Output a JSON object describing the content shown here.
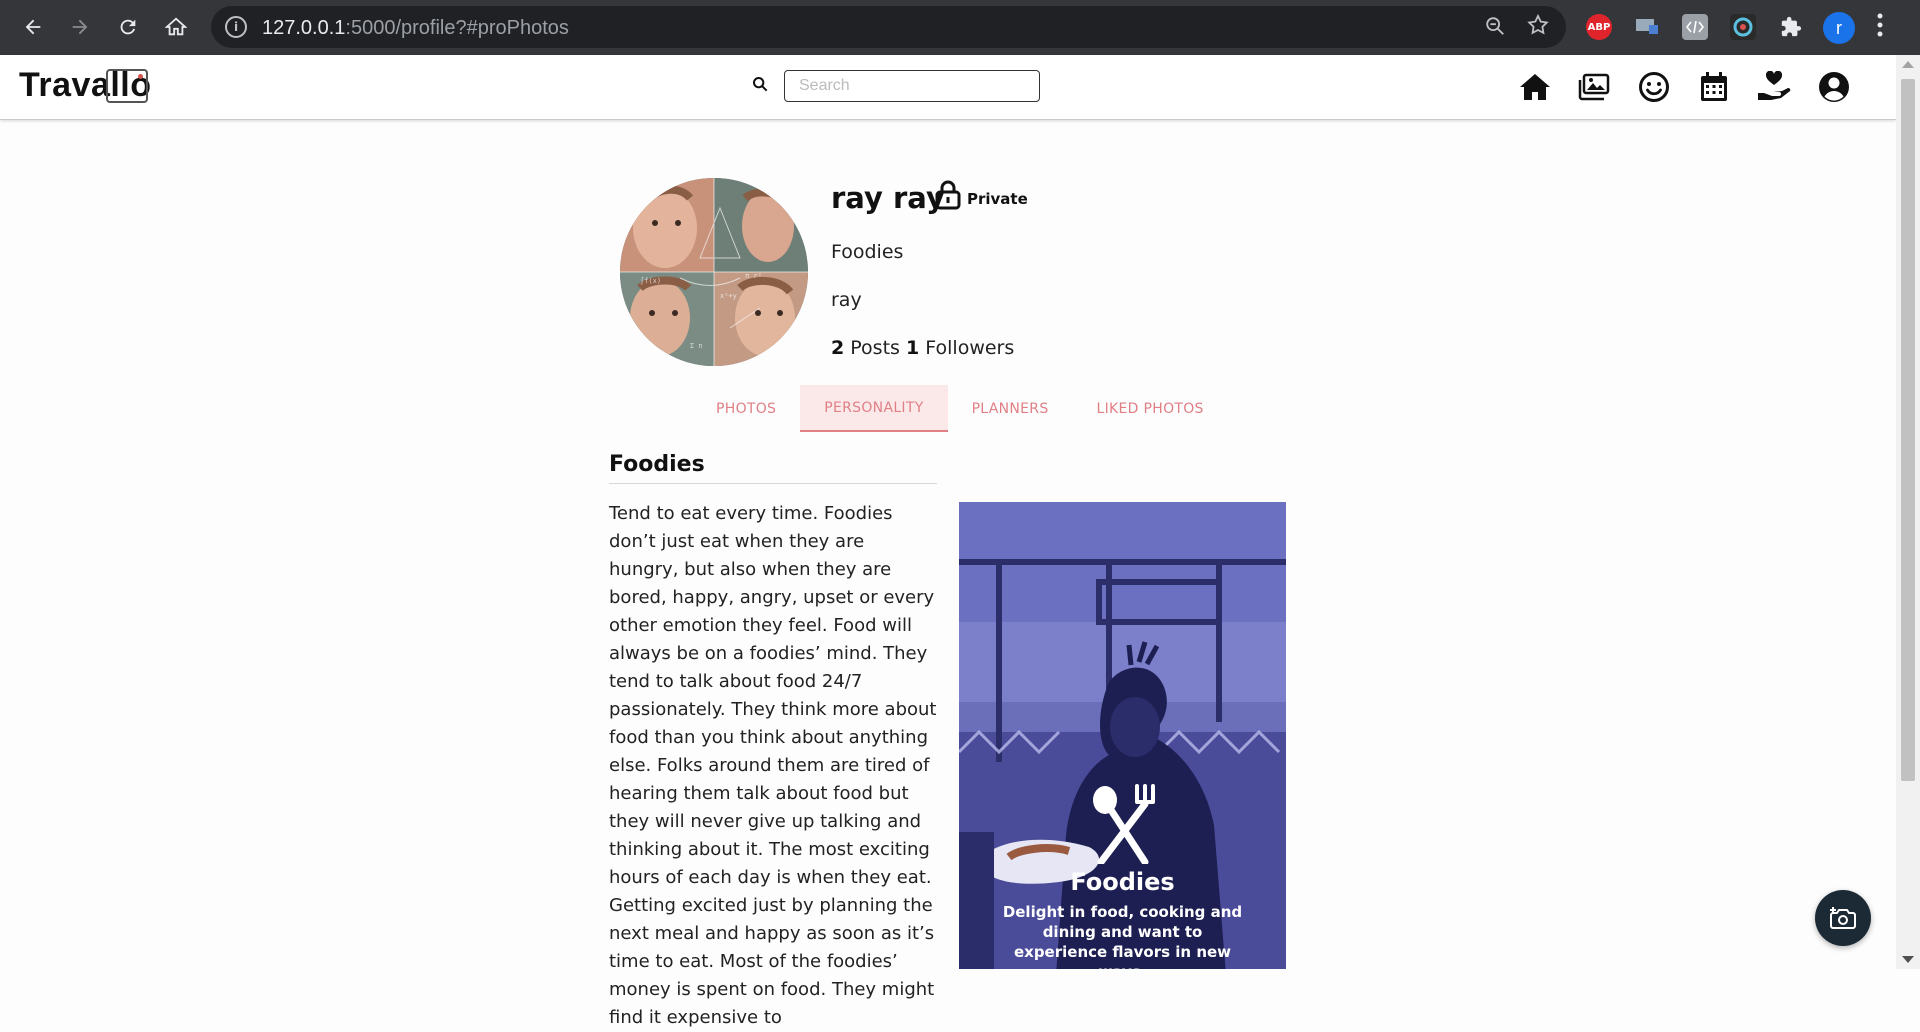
{
  "browser": {
    "url_host": "127.0.0.1",
    "url_rest": ":5000/profile?#proPhotos",
    "info_glyph": "i",
    "extension_abp": "ABP",
    "profile_initial": "r"
  },
  "header": {
    "logo": "Travallo",
    "search_placeholder": "Search",
    "nav_icons": [
      "home-icon",
      "photos-icon",
      "personality-icon",
      "calendar-icon",
      "donate-icon",
      "account-icon"
    ]
  },
  "profile": {
    "name": "ray ray",
    "privacy": "Private",
    "personality": "Foodies",
    "bio": "ray",
    "posts_count": "2",
    "posts_label": "Posts",
    "followers_count": "1",
    "followers_label": "Followers"
  },
  "tabs": [
    {
      "label": "PHOTOS",
      "active": false
    },
    {
      "label": "PERSONALITY",
      "active": true
    },
    {
      "label": "PLANNERS",
      "active": false
    },
    {
      "label": "LIKED PHOTOS",
      "active": false
    }
  ],
  "personality_section": {
    "title": "Foodies",
    "description": "Tend to eat every time. Foodies don’t just eat when they are hungry, but also when they are bored, happy, angry, upset or every other emotion they feel. Food will always be on a foodies’ mind. They tend to talk about food 24/7 passionately. They think more about food than you think about anything else. Folks around them are tired of hearing them talk about food but they will never give up talking and thinking about it. The most exciting hours of each day is when they eat. Getting excited just by planning the next meal and happy as soon as it’s time to eat. Most of the foodies’ money is spent on food. They might find it expensive to",
    "card_title": "Foodies",
    "card_tagline": "Delight in food, cooking and dining and want to experience flavors in new ways."
  },
  "colors": {
    "accent": "#e07f86",
    "tab_active_bg": "#fbe9ea",
    "card_overlay": "#3f3f8e",
    "fab_bg": "#1b2a35"
  }
}
